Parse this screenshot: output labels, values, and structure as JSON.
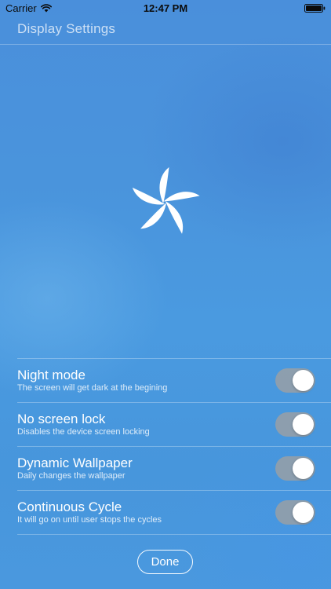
{
  "status_bar": {
    "carrier": "Carrier",
    "time": "12:47 PM",
    "wifi_icon": "wifi-icon",
    "battery_icon": "battery-icon"
  },
  "header": {
    "title": "Display Settings"
  },
  "logo": {
    "icon": "flower-logo-icon"
  },
  "settings": [
    {
      "title": "Night mode",
      "subtitle": "The screen will get dark at the begining",
      "enabled": true
    },
    {
      "title": "No screen lock",
      "subtitle": "Disables the device screen locking",
      "enabled": true
    },
    {
      "title": "Dynamic Wallpaper",
      "subtitle": "Daily changes the wallpaper",
      "enabled": true
    },
    {
      "title": "Continuous Cycle",
      "subtitle": "It will go on until user stops the cycles",
      "enabled": true
    }
  ],
  "done_button": {
    "label": "Done"
  },
  "colors": {
    "background": "#4a94dc",
    "toggle_track": "#a0a0a0",
    "toggle_knob": "#ffffff",
    "text": "#ffffff"
  }
}
